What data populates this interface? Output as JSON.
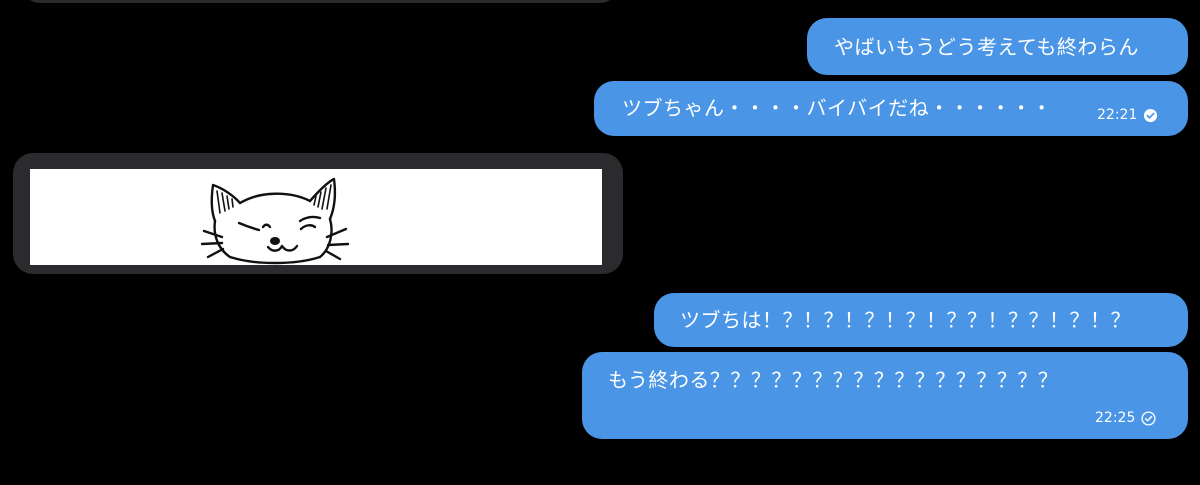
{
  "messages": [
    {
      "text": "やばいもうどう考えても終わらん"
    },
    {
      "text": "ツブちゃん・・・・バイバイだね・・・・・・",
      "time": "22:21",
      "status_icon": "check-circle-icon"
    },
    {
      "text": "ツブちは！？！？！？！？！？？！？？！？！？"
    },
    {
      "text": "もう終わる？？？？？？？？？？？？？？？？？",
      "time": "22:25",
      "status_icon": "check-circle-icon"
    }
  ],
  "sticker": {
    "subject": "cat-face"
  },
  "colors": {
    "background": "#000000",
    "outgoing_bubble": "#4a95e6",
    "incoming_frame": "#2b2b2e",
    "text": "#ffffff"
  }
}
